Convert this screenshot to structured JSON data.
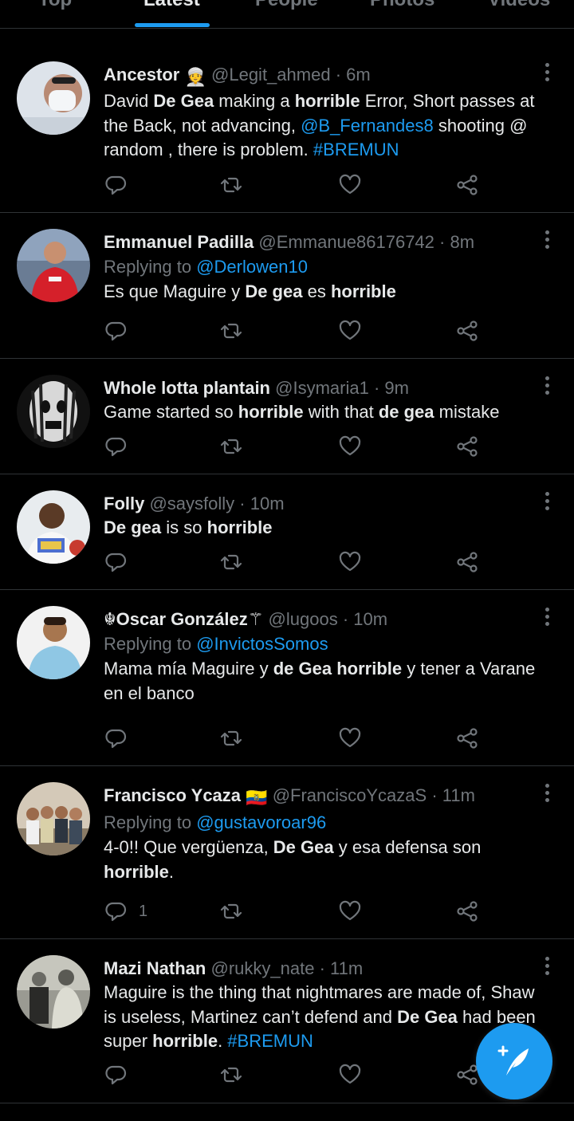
{
  "tabs": [
    {
      "label": "Top"
    },
    {
      "label": "Latest",
      "active": true
    },
    {
      "label": "People"
    },
    {
      "label": "Photos"
    },
    {
      "label": "Videos"
    }
  ],
  "tweets": [
    {
      "name": "Ancestor",
      "name_emoji": "👳",
      "handle": "@Legit_ahmed",
      "time": "6m",
      "text_parts": [
        {
          "t": "David "
        },
        {
          "t": "De Gea",
          "b": true
        },
        {
          "t": " making a "
        },
        {
          "t": "horrible",
          "b": true
        },
        {
          "t": " Error, Short passes at the Back, not advancing, "
        },
        {
          "t": "@B_Fernandes8",
          "link": true
        },
        {
          "t": " shooting @ random , there is problem. "
        },
        {
          "t": "#BREMUN",
          "link": true
        }
      ]
    },
    {
      "name": "Emmanuel Padilla",
      "handle": "@Emmanue86176742",
      "time": "8m",
      "replying_to_label": "Replying to",
      "replying_to": "@Derlowen10",
      "text_parts": [
        {
          "t": "Es que Maguire y "
        },
        {
          "t": "De gea",
          "b": true
        },
        {
          "t": " es "
        },
        {
          "t": "horrible",
          "b": true
        }
      ]
    },
    {
      "name": "Whole lotta plantain",
      "handle": "@Isymaria1",
      "time": "9m",
      "text_parts": [
        {
          "t": "Game started so "
        },
        {
          "t": "horrible",
          "b": true
        },
        {
          "t": " with that "
        },
        {
          "t": "de gea",
          "b": true
        },
        {
          "t": " mistake"
        }
      ]
    },
    {
      "name": "Folly",
      "handle": "@saysfolly",
      "time": "10m",
      "text_parts": [
        {
          "t": "De gea",
          "b": true
        },
        {
          "t": " is so "
        },
        {
          "t": "horrible",
          "b": true
        }
      ]
    },
    {
      "name": "☬Oscar González⚚",
      "handle": "@lugoos",
      "time": "10m",
      "replying_to_label": "Replying to",
      "replying_to": "@InvictosSomos",
      "text_parts": [
        {
          "t": "Mama mía Maguire y "
        },
        {
          "t": "de Gea horrible",
          "b": true
        },
        {
          "t": " y tener a Varane en el banco"
        }
      ]
    },
    {
      "name": "Francisco Ycaza",
      "name_emoji": "🇪🇨",
      "handle": "@FranciscoYcazaS",
      "time": "11m",
      "replying_to_label": "Replying to",
      "replying_to": "@gustavoroar96",
      "reply_count": "1",
      "text_parts": [
        {
          "t": "4-0!! Que vergüenza, "
        },
        {
          "t": "De Gea",
          "b": true
        },
        {
          "t": " y esa defensa son "
        },
        {
          "t": "horrible",
          "b": true
        },
        {
          "t": "."
        }
      ]
    },
    {
      "name": "Mazi Nathan",
      "handle": "@rukky_nate",
      "time": "11m",
      "text_parts": [
        {
          "t": "Maguire is the thing that nightmares are made of, Shaw is useless, Martinez can’t defend and "
        },
        {
          "t": "De Gea",
          "b": true
        },
        {
          "t": " had been super "
        },
        {
          "t": "horrible",
          "b": true
        },
        {
          "t": ". "
        },
        {
          "t": "#BREMUN",
          "link": true
        }
      ]
    }
  ],
  "separator_dot": "·",
  "icons": {
    "reply": "reply-icon",
    "retweet": "retweet-icon",
    "like": "heart-icon",
    "share": "share-icon",
    "more": "more-icon",
    "compose": "compose-tweet-icon"
  },
  "colors": {
    "background": "#000000",
    "accent": "#1d9bf0",
    "text": "#e7e9ea",
    "muted": "#71767b",
    "divider": "#2f3336"
  }
}
